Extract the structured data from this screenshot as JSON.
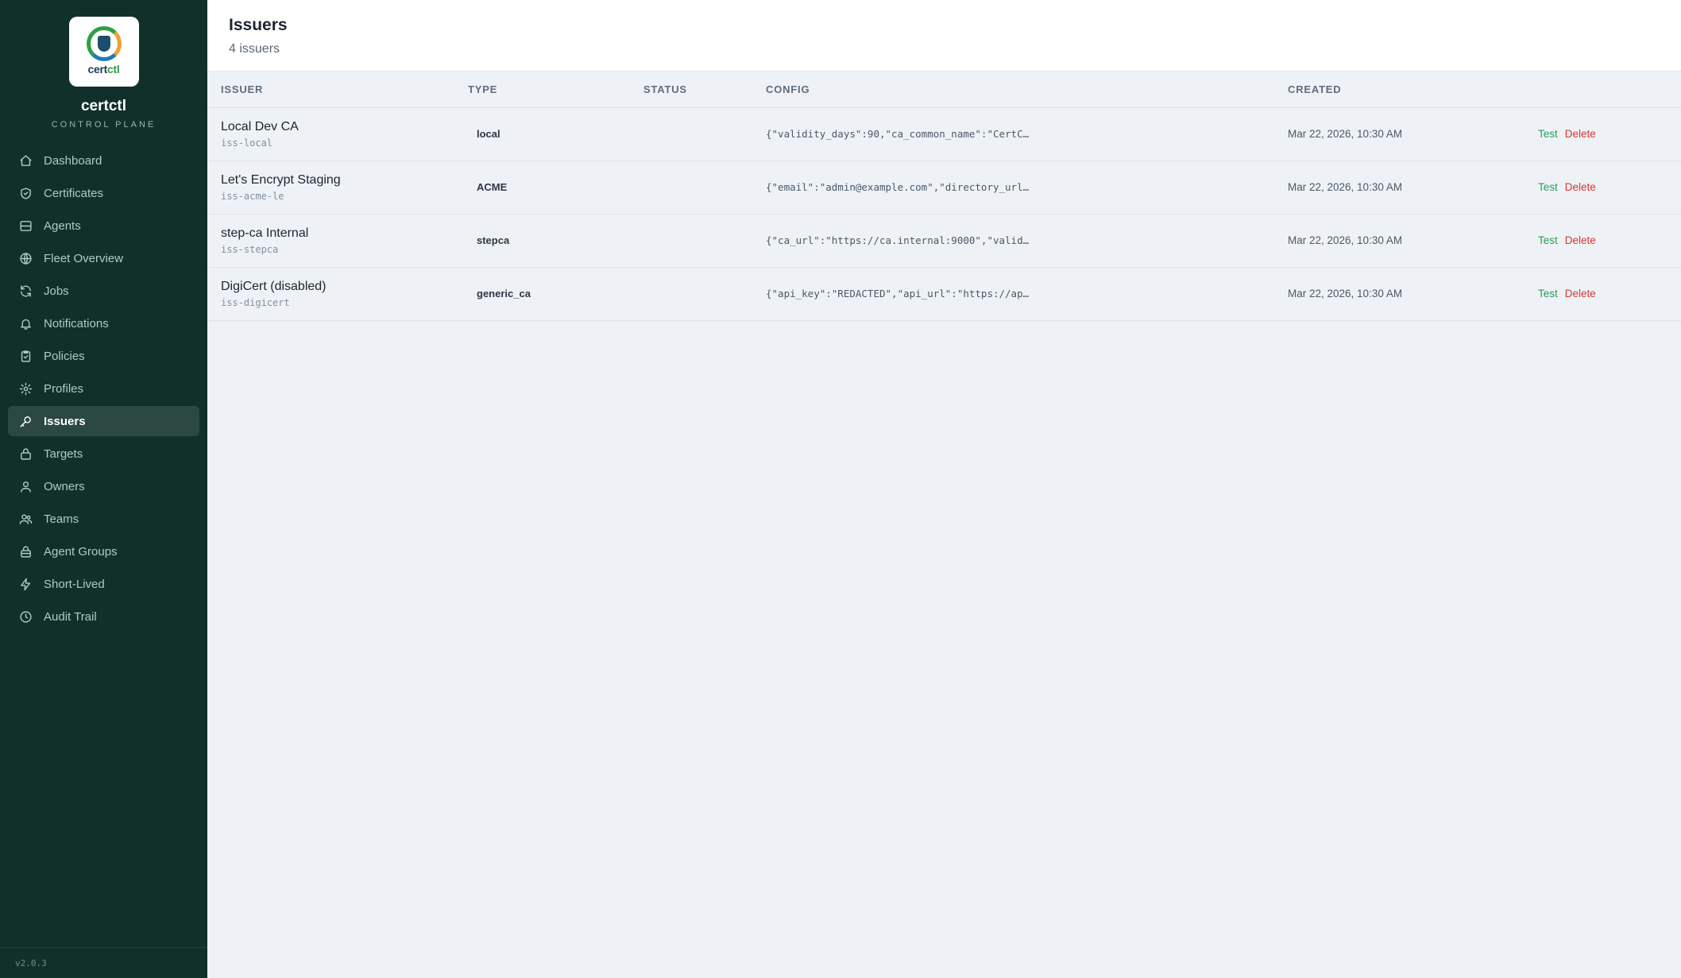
{
  "brand": {
    "logo_text_a": "cert",
    "logo_text_b": "ctl",
    "name": "certctl",
    "subtitle": "CONTROL PLANE",
    "version": "v2.0.3"
  },
  "nav": [
    {
      "label": "Dashboard",
      "icon": "home-icon"
    },
    {
      "label": "Certificates",
      "icon": "shield-check-icon"
    },
    {
      "label": "Agents",
      "icon": "server-icon"
    },
    {
      "label": "Fleet Overview",
      "icon": "globe-icon"
    },
    {
      "label": "Jobs",
      "icon": "refresh-icon"
    },
    {
      "label": "Notifications",
      "icon": "bell-icon"
    },
    {
      "label": "Policies",
      "icon": "clipboard-check-icon"
    },
    {
      "label": "Profiles",
      "icon": "gear-icon"
    },
    {
      "label": "Issuers",
      "icon": "key-icon",
      "active": true
    },
    {
      "label": "Targets",
      "icon": "lock-icon"
    },
    {
      "label": "Owners",
      "icon": "user-icon"
    },
    {
      "label": "Teams",
      "icon": "users-icon"
    },
    {
      "label": "Agent Groups",
      "icon": "lock-group-icon"
    },
    {
      "label": "Short-Lived",
      "icon": "lightning-icon"
    },
    {
      "label": "Audit Trail",
      "icon": "clock-icon"
    }
  ],
  "header": {
    "title": "Issuers",
    "count": "4 issuers"
  },
  "table": {
    "columns": [
      "ISSUER",
      "TYPE",
      "STATUS",
      "CONFIG",
      "CREATED"
    ],
    "rows": [
      {
        "name": "Local Dev CA",
        "id": "iss-local",
        "type": "local",
        "status": "",
        "config": "{\"validity_days\":90,\"ca_common_name\":\"CertC…",
        "created": "Mar 22, 2026, 10:30 AM",
        "test": "Test",
        "delete": "Delete"
      },
      {
        "name": "Let's Encrypt Staging",
        "id": "iss-acme-le",
        "type": "ACME",
        "status": "",
        "config": "{\"email\":\"admin@example.com\",\"directory_url…",
        "created": "Mar 22, 2026, 10:30 AM",
        "test": "Test",
        "delete": "Delete"
      },
      {
        "name": "step-ca Internal",
        "id": "iss-stepca",
        "type": "stepca",
        "status": "",
        "config": "{\"ca_url\":\"https://ca.internal:9000\",\"valid…",
        "created": "Mar 22, 2026, 10:30 AM",
        "test": "Test",
        "delete": "Delete"
      },
      {
        "name": "DigiCert (disabled)",
        "id": "iss-digicert",
        "type": "generic_ca",
        "status": "",
        "config": "{\"api_key\":\"REDACTED\",\"api_url\":\"https://ap…",
        "created": "Mar 22, 2026, 10:30 AM",
        "test": "Test",
        "delete": "Delete"
      }
    ]
  },
  "colors": {
    "sidebar_bg": "#12302a",
    "active_bg": "#2b4841",
    "test": "#2a9a5c",
    "delete": "#d6362f"
  }
}
